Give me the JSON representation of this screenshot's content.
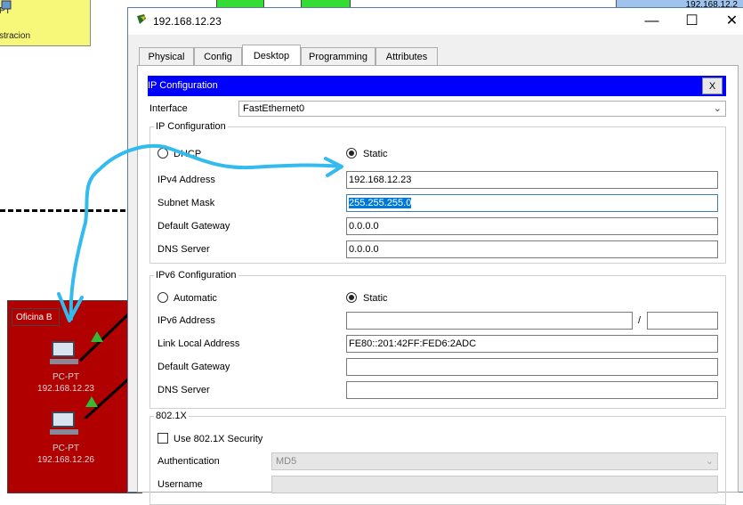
{
  "background": {
    "yellow_box": {
      "line1": "PT",
      "line2": "stracion"
    },
    "blue_box": {
      "label": "192.168.12.2"
    },
    "office": {
      "label": "Oficina B"
    },
    "pcs": [
      {
        "type": "PC-PT",
        "ip": "192.168.12.23"
      },
      {
        "type": "PC-PT",
        "ip": "192.168.12.26"
      }
    ]
  },
  "window": {
    "title": "192.168.12.23",
    "minimize": "—",
    "maximize": "☐",
    "close": "✕"
  },
  "tabs": [
    {
      "label": "Physical"
    },
    {
      "label": "Config"
    },
    {
      "label": "Desktop"
    },
    {
      "label": "Programming"
    },
    {
      "label": "Attributes"
    }
  ],
  "active_tab": "Desktop",
  "ip_config": {
    "header": "IP Configuration",
    "close_label": "X",
    "interface_label": "Interface",
    "interface_value": "FastEthernet0",
    "ipv4": {
      "group_title": "IP Configuration",
      "dhcp_label": "DHCP",
      "static_label": "Static",
      "selected": "Static",
      "fields": {
        "ipv4_label": "IPv4 Address",
        "ipv4_value": "192.168.12.23",
        "mask_label": "Subnet Mask",
        "mask_value": "255.255.255.0",
        "gateway_label": "Default Gateway",
        "gateway_value": "0.0.0.0",
        "dns_label": "DNS Server",
        "dns_value": "0.0.0.0"
      }
    },
    "ipv6": {
      "group_title": "IPv6 Configuration",
      "automatic_label": "Automatic",
      "static_label": "Static",
      "selected": "Static",
      "address_label": "IPv6 Address",
      "address_value": "",
      "slash": "/",
      "prefix_value": "",
      "link_local_label": "Link Local Address",
      "link_local_value": "FE80::201:42FF:FED6:2ADC",
      "gateway_label": "Default Gateway",
      "gateway_value": "",
      "dns_label": "DNS Server",
      "dns_value": ""
    },
    "dot1x": {
      "group_title": "802.1X",
      "use_label": "Use 802.1X Security",
      "checked": false,
      "auth_label": "Authentication",
      "auth_value": "MD5",
      "username_label": "Username"
    }
  },
  "colors": {
    "header_blue": "#0000ff",
    "office_red": "#b00000",
    "annotation_arrow": "#33bbee"
  }
}
